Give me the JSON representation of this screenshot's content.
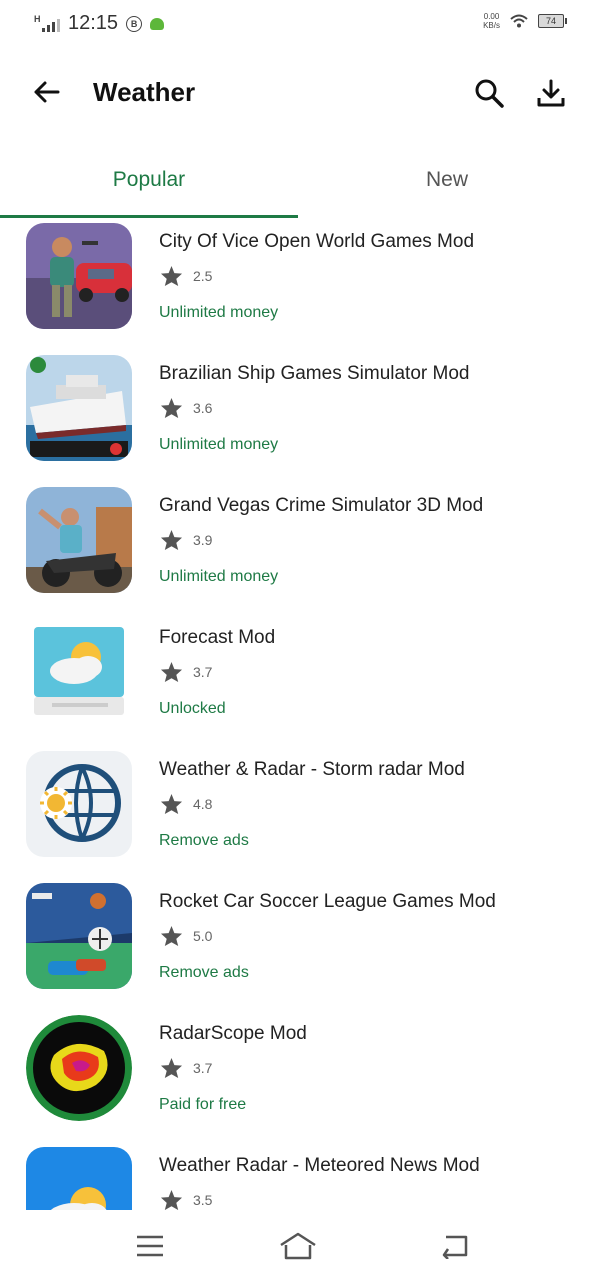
{
  "status_bar": {
    "time": "12:15",
    "network_type": "H",
    "badge_b": "B",
    "speed_value": "0.00",
    "speed_unit": "KB/s",
    "battery": "74"
  },
  "header": {
    "title": "Weather"
  },
  "tabs": [
    {
      "label": "Popular"
    },
    {
      "label": "New"
    }
  ],
  "apps": [
    {
      "name": "City Of Vice Open World Games Mod",
      "rating": "2.5",
      "mod": "Unlimited money"
    },
    {
      "name": "Brazilian Ship Games Simulator Mod",
      "rating": "3.6",
      "mod": "Unlimited money"
    },
    {
      "name": "Grand Vegas Crime Simulator 3D Mod",
      "rating": "3.9",
      "mod": "Unlimited money"
    },
    {
      "name": "Forecast Mod",
      "rating": "3.7",
      "mod": "Unlocked"
    },
    {
      "name": "Weather & Radar - Storm radar Mod",
      "rating": "4.8",
      "mod": "Remove ads"
    },
    {
      "name": "Rocket Car Soccer League Games Mod",
      "rating": "5.0",
      "mod": "Remove ads"
    },
    {
      "name": "RadarScope Mod",
      "rating": "3.7",
      "mod": "Paid for free"
    },
    {
      "name": "Weather Radar - Meteored News Mod",
      "rating": "3.5",
      "mod": ""
    }
  ],
  "colors": {
    "accent": "#1e7a45",
    "star": "#555555"
  },
  "icons": {
    "back": "arrow-left-icon",
    "search": "search-icon",
    "download": "download-icon",
    "rating": "star-icon",
    "nav_menu": "menu-icon",
    "nav_home": "home-icon",
    "nav_back": "back-icon"
  }
}
